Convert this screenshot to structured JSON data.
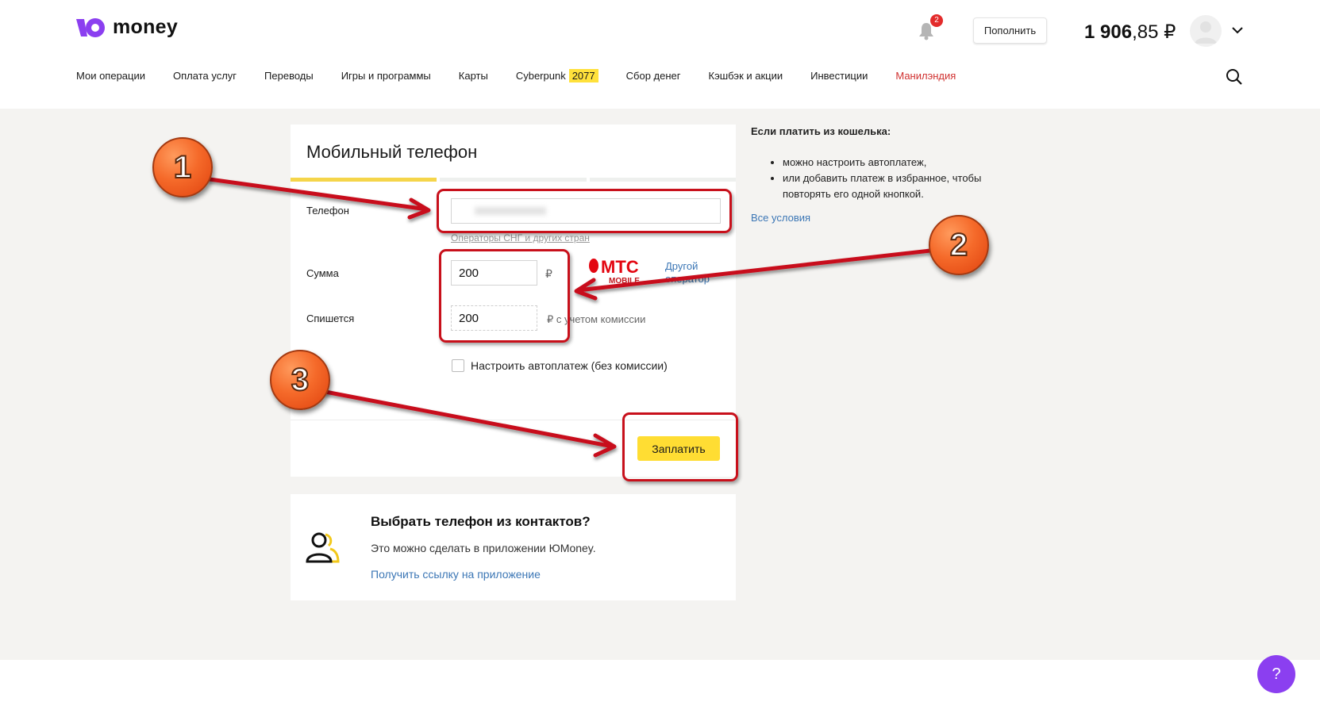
{
  "header": {
    "logo_text": "money",
    "notifications_count": "2",
    "topup_label": "Пополнить",
    "balance_int": "1 906",
    "balance_frac": ",85 ₽",
    "icons": [
      "bell-icon",
      "avatar-icon",
      "chevron-down-icon",
      "search-icon"
    ]
  },
  "nav": {
    "items": [
      {
        "label": "Мои операции"
      },
      {
        "label": "Оплата услуг"
      },
      {
        "label": "Переводы"
      },
      {
        "label": "Игры и программы"
      },
      {
        "label": "Карты"
      },
      {
        "label": "Cyberpunk",
        "badge": "2077"
      },
      {
        "label": "Сбор денег"
      },
      {
        "label": "Кэшбэк и акции"
      },
      {
        "label": "Инвестиции"
      },
      {
        "label": "Манилэндия"
      }
    ]
  },
  "form": {
    "title": "Мобильный телефон",
    "phone_label": "Телефон",
    "phone_value": "",
    "operators_link": "Операторы СНГ и других стран",
    "amount_label": "Сумма",
    "amount_value": "200",
    "currency": "₽",
    "charged_label": "Спишется",
    "charged_value": "200",
    "commission_note": "₽ с учетом комиссии",
    "operator_logo": "МТС",
    "operator_sub": "MOBILE",
    "other_operator_link": "Другой оператор",
    "autopay_label": "Настроить автоплатеж (без комиссии)",
    "autopay_checked": false,
    "pay_label": "Заплатить"
  },
  "contacts": {
    "title": "Выбрать телефон из контактов?",
    "text": "Это можно сделать в приложении ЮMoney.",
    "link": "Получить ссылку на приложение"
  },
  "sidebar": {
    "title": "Если платить из кошелька:",
    "bullets": [
      "можно настроить автоплатеж,",
      "или добавить платеж в избранное, чтобы повторять его одной кнопкой."
    ],
    "link": "Все условия"
  },
  "help_label": "?",
  "annotations": [
    "1",
    "2",
    "3"
  ],
  "colors": {
    "brand": "#8b3ff0",
    "accent_yellow": "#ffdd33",
    "link": "#3b76b5",
    "annotation_red": "#c8101b"
  }
}
